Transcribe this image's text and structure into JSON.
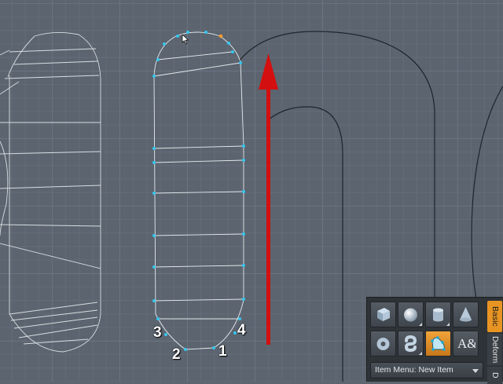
{
  "viewport": {
    "vertex_labels": [
      "1",
      "2",
      "3",
      "4"
    ],
    "arrow_color": "#d40f0f",
    "wire_color": "#dfe3e6",
    "vertex_color": "#35c6ee",
    "selected_vertex_color": "#ff9a2e"
  },
  "toolbox": {
    "tools_row1": [
      "cube-icon",
      "sphere-icon",
      "cylinder-icon",
      "cone-icon"
    ],
    "tools_row2": [
      "torus-icon",
      "capsule-icon",
      "pen-tool-icon",
      "text-tool-icon"
    ],
    "text_tool_glyph": "A&",
    "active_tool": "pen-tool-icon",
    "item_menu_label": "Item Menu: New Item",
    "tabs": [
      "Basic",
      "Deform",
      "D"
    ],
    "active_tab": "Basic",
    "accent_color": "#e89423"
  }
}
